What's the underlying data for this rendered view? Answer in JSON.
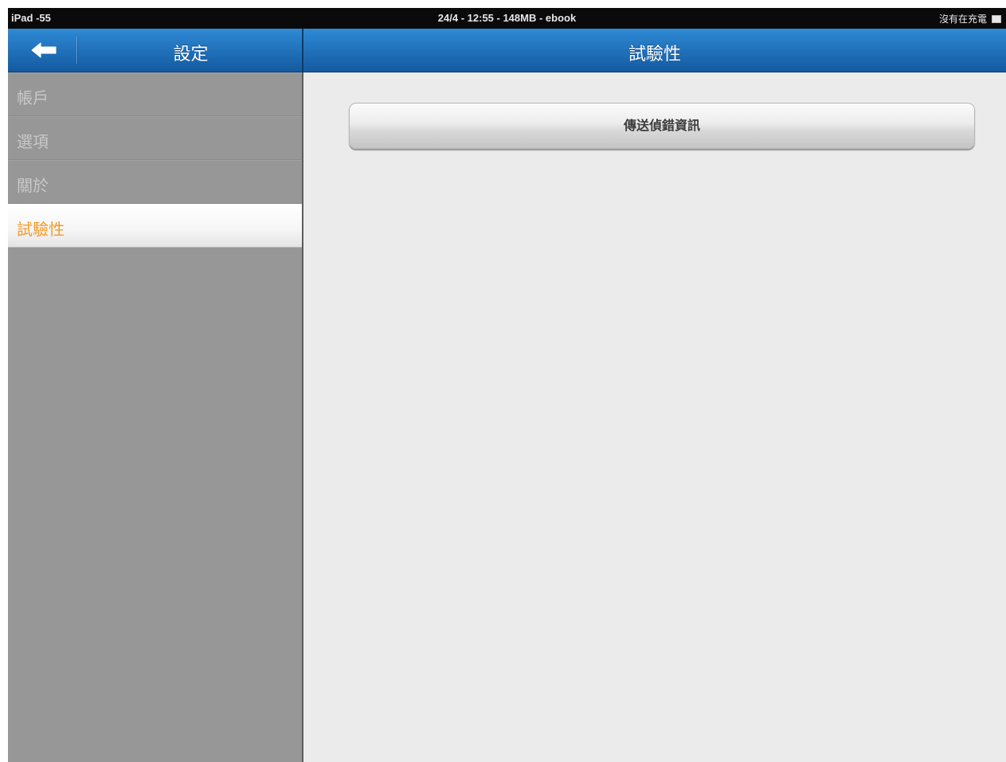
{
  "status_bar": {
    "device": "iPad -55",
    "center": "24/4 - 12:55 - 148MB - ebook",
    "charging": "沒有在充電"
  },
  "nav": {
    "back_icon": "back-arrow-icon",
    "left_title": "設定",
    "right_title": "試驗性"
  },
  "sidebar": {
    "items": [
      {
        "label": "帳戶",
        "active": false
      },
      {
        "label": "選項",
        "active": false
      },
      {
        "label": "關於",
        "active": false
      },
      {
        "label": "試驗性",
        "active": true
      }
    ]
  },
  "content": {
    "send_debug_button": "傳送偵錯資訊"
  },
  "colors": {
    "nav_blue": "#1f6fb8",
    "sidebar_gray": "#979797",
    "active_orange": "#f39a2b",
    "content_bg": "#ebebeb"
  }
}
